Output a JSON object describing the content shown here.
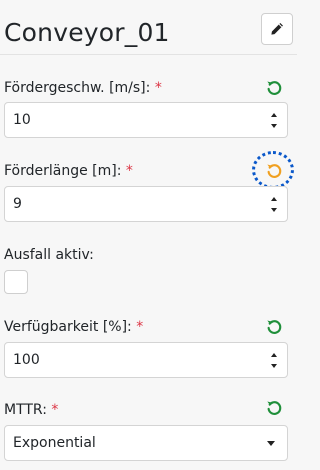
{
  "header": {
    "title": "Conveyor_01",
    "edit_icon": "pencil-icon"
  },
  "fields": {
    "speed": {
      "label": "Fördergeschw. [m/s]:",
      "required_mark": "*",
      "value": "10",
      "reset_icon": "reset-icon",
      "reset_color": "#1f8f3a"
    },
    "length": {
      "label": "Förderlänge [m]:",
      "required_mark": "*",
      "value": "9",
      "reset_icon": "reset-icon",
      "reset_color": "#f0a020"
    },
    "failure": {
      "label": "Ausfall aktiv:",
      "checked": false
    },
    "availability": {
      "label": "Verfügbarkeit [%]:",
      "required_mark": "*",
      "value": "100",
      "reset_icon": "reset-icon",
      "reset_color": "#1f8f3a"
    },
    "mttr": {
      "label": "MTTR:",
      "required_mark": "*",
      "selected": "Exponential",
      "reset_icon": "reset-icon",
      "reset_color": "#1f8f3a"
    }
  },
  "colors": {
    "required": "#dc3545",
    "focus": "#0a58ca"
  }
}
